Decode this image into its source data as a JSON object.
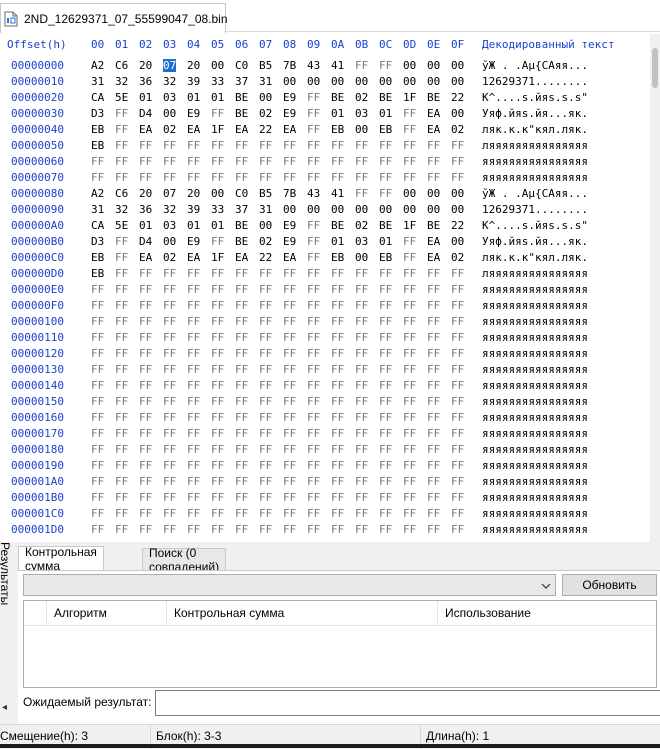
{
  "file_tab": {
    "name": "2ND_12629371_07_55599047_08.bin",
    "icon": "binary-file-icon"
  },
  "hex_header": {
    "offset": "Offset(h)",
    "columns": [
      "00",
      "01",
      "02",
      "03",
      "04",
      "05",
      "06",
      "07",
      "08",
      "09",
      "0A",
      "0B",
      "0C",
      "0D",
      "0E",
      "0F"
    ],
    "decoded": "Декодированный текст"
  },
  "hex_rows": [
    {
      "offset": "00000000",
      "bytes": [
        "A2",
        "C6",
        "20",
        "07",
        "20",
        "00",
        "C0",
        "B5",
        "7B",
        "43",
        "41",
        "FF",
        "FF",
        "00",
        "00",
        "00"
      ],
      "text": "ўЖ . .Аµ{CAяя...",
      "selected_index": 3
    },
    {
      "offset": "00000010",
      "bytes": [
        "31",
        "32",
        "36",
        "32",
        "39",
        "33",
        "37",
        "31",
        "00",
        "00",
        "00",
        "00",
        "00",
        "00",
        "00",
        "00"
      ],
      "text": "12629371........"
    },
    {
      "offset": "00000020",
      "bytes": [
        "CA",
        "5E",
        "01",
        "03",
        "01",
        "01",
        "BE",
        "00",
        "E9",
        "FF",
        "BE",
        "02",
        "BE",
        "1F",
        "BE",
        "22"
      ],
      "text": "К^....s.йяs.s.s\""
    },
    {
      "offset": "00000030",
      "bytes": [
        "D3",
        "FF",
        "D4",
        "00",
        "E9",
        "FF",
        "BE",
        "02",
        "E9",
        "FF",
        "01",
        "03",
        "01",
        "FF",
        "EA",
        "00"
      ],
      "text": "Уяф.йяs.йя...як."
    },
    {
      "offset": "00000040",
      "bytes": [
        "EB",
        "FF",
        "EA",
        "02",
        "EA",
        "1F",
        "EA",
        "22",
        "EA",
        "FF",
        "EB",
        "00",
        "EB",
        "FF",
        "EA",
        "02"
      ],
      "text": "ляк.к.к\"кял.ляк."
    },
    {
      "offset": "00000050",
      "bytes": [
        "EB",
        "FF",
        "FF",
        "FF",
        "FF",
        "FF",
        "FF",
        "FF",
        "FF",
        "FF",
        "FF",
        "FF",
        "FF",
        "FF",
        "FF",
        "FF"
      ],
      "text": "ляяяяяяяяяяяяяяя"
    },
    {
      "offset": "00000060",
      "bytes": [
        "FF",
        "FF",
        "FF",
        "FF",
        "FF",
        "FF",
        "FF",
        "FF",
        "FF",
        "FF",
        "FF",
        "FF",
        "FF",
        "FF",
        "FF",
        "FF"
      ],
      "text": "яяяяяяяяяяяяяяяя"
    },
    {
      "offset": "00000070",
      "bytes": [
        "FF",
        "FF",
        "FF",
        "FF",
        "FF",
        "FF",
        "FF",
        "FF",
        "FF",
        "FF",
        "FF",
        "FF",
        "FF",
        "FF",
        "FF",
        "FF"
      ],
      "text": "яяяяяяяяяяяяяяяя"
    },
    {
      "offset": "00000080",
      "bytes": [
        "A2",
        "C6",
        "20",
        "07",
        "20",
        "00",
        "C0",
        "B5",
        "7B",
        "43",
        "41",
        "FF",
        "FF",
        "00",
        "00",
        "00"
      ],
      "text": "ўЖ . .Аµ{CAяя..."
    },
    {
      "offset": "00000090",
      "bytes": [
        "31",
        "32",
        "36",
        "32",
        "39",
        "33",
        "37",
        "31",
        "00",
        "00",
        "00",
        "00",
        "00",
        "00",
        "00",
        "00"
      ],
      "text": "12629371........"
    },
    {
      "offset": "000000A0",
      "bytes": [
        "CA",
        "5E",
        "01",
        "03",
        "01",
        "01",
        "BE",
        "00",
        "E9",
        "FF",
        "BE",
        "02",
        "BE",
        "1F",
        "BE",
        "22"
      ],
      "text": "К^....s.йяs.s.s\""
    },
    {
      "offset": "000000B0",
      "bytes": [
        "D3",
        "FF",
        "D4",
        "00",
        "E9",
        "FF",
        "BE",
        "02",
        "E9",
        "FF",
        "01",
        "03",
        "01",
        "FF",
        "EA",
        "00"
      ],
      "text": "Уяф.йяs.йя...як."
    },
    {
      "offset": "000000C0",
      "bytes": [
        "EB",
        "FF",
        "EA",
        "02",
        "EA",
        "1F",
        "EA",
        "22",
        "EA",
        "FF",
        "EB",
        "00",
        "EB",
        "FF",
        "EA",
        "02"
      ],
      "text": "ляк.к.к\"кял.ляк."
    },
    {
      "offset": "000000D0",
      "bytes": [
        "EB",
        "FF",
        "FF",
        "FF",
        "FF",
        "FF",
        "FF",
        "FF",
        "FF",
        "FF",
        "FF",
        "FF",
        "FF",
        "FF",
        "FF",
        "FF"
      ],
      "text": "ляяяяяяяяяяяяяяя"
    },
    {
      "offset": "000000E0",
      "bytes": [
        "FF",
        "FF",
        "FF",
        "FF",
        "FF",
        "FF",
        "FF",
        "FF",
        "FF",
        "FF",
        "FF",
        "FF",
        "FF",
        "FF",
        "FF",
        "FF"
      ],
      "text": "яяяяяяяяяяяяяяяя"
    },
    {
      "offset": "000000F0",
      "bytes": [
        "FF",
        "FF",
        "FF",
        "FF",
        "FF",
        "FF",
        "FF",
        "FF",
        "FF",
        "FF",
        "FF",
        "FF",
        "FF",
        "FF",
        "FF",
        "FF"
      ],
      "text": "яяяяяяяяяяяяяяяя"
    },
    {
      "offset": "00000100",
      "bytes": [
        "FF",
        "FF",
        "FF",
        "FF",
        "FF",
        "FF",
        "FF",
        "FF",
        "FF",
        "FF",
        "FF",
        "FF",
        "FF",
        "FF",
        "FF",
        "FF"
      ],
      "text": "яяяяяяяяяяяяяяяя"
    },
    {
      "offset": "00000110",
      "bytes": [
        "FF",
        "FF",
        "FF",
        "FF",
        "FF",
        "FF",
        "FF",
        "FF",
        "FF",
        "FF",
        "FF",
        "FF",
        "FF",
        "FF",
        "FF",
        "FF"
      ],
      "text": "яяяяяяяяяяяяяяяя"
    },
    {
      "offset": "00000120",
      "bytes": [
        "FF",
        "FF",
        "FF",
        "FF",
        "FF",
        "FF",
        "FF",
        "FF",
        "FF",
        "FF",
        "FF",
        "FF",
        "FF",
        "FF",
        "FF",
        "FF"
      ],
      "text": "яяяяяяяяяяяяяяяя"
    },
    {
      "offset": "00000130",
      "bytes": [
        "FF",
        "FF",
        "FF",
        "FF",
        "FF",
        "FF",
        "FF",
        "FF",
        "FF",
        "FF",
        "FF",
        "FF",
        "FF",
        "FF",
        "FF",
        "FF"
      ],
      "text": "яяяяяяяяяяяяяяяя"
    },
    {
      "offset": "00000140",
      "bytes": [
        "FF",
        "FF",
        "FF",
        "FF",
        "FF",
        "FF",
        "FF",
        "FF",
        "FF",
        "FF",
        "FF",
        "FF",
        "FF",
        "FF",
        "FF",
        "FF"
      ],
      "text": "яяяяяяяяяяяяяяяя"
    },
    {
      "offset": "00000150",
      "bytes": [
        "FF",
        "FF",
        "FF",
        "FF",
        "FF",
        "FF",
        "FF",
        "FF",
        "FF",
        "FF",
        "FF",
        "FF",
        "FF",
        "FF",
        "FF",
        "FF"
      ],
      "text": "яяяяяяяяяяяяяяяя"
    },
    {
      "offset": "00000160",
      "bytes": [
        "FF",
        "FF",
        "FF",
        "FF",
        "FF",
        "FF",
        "FF",
        "FF",
        "FF",
        "FF",
        "FF",
        "FF",
        "FF",
        "FF",
        "FF",
        "FF"
      ],
      "text": "яяяяяяяяяяяяяяяя"
    },
    {
      "offset": "00000170",
      "bytes": [
        "FF",
        "FF",
        "FF",
        "FF",
        "FF",
        "FF",
        "FF",
        "FF",
        "FF",
        "FF",
        "FF",
        "FF",
        "FF",
        "FF",
        "FF",
        "FF"
      ],
      "text": "яяяяяяяяяяяяяяяя"
    },
    {
      "offset": "00000180",
      "bytes": [
        "FF",
        "FF",
        "FF",
        "FF",
        "FF",
        "FF",
        "FF",
        "FF",
        "FF",
        "FF",
        "FF",
        "FF",
        "FF",
        "FF",
        "FF",
        "FF"
      ],
      "text": "яяяяяяяяяяяяяяяя"
    },
    {
      "offset": "00000190",
      "bytes": [
        "FF",
        "FF",
        "FF",
        "FF",
        "FF",
        "FF",
        "FF",
        "FF",
        "FF",
        "FF",
        "FF",
        "FF",
        "FF",
        "FF",
        "FF",
        "FF"
      ],
      "text": "яяяяяяяяяяяяяяяя"
    },
    {
      "offset": "000001A0",
      "bytes": [
        "FF",
        "FF",
        "FF",
        "FF",
        "FF",
        "FF",
        "FF",
        "FF",
        "FF",
        "FF",
        "FF",
        "FF",
        "FF",
        "FF",
        "FF",
        "FF"
      ],
      "text": "яяяяяяяяяяяяяяяя"
    },
    {
      "offset": "000001B0",
      "bytes": [
        "FF",
        "FF",
        "FF",
        "FF",
        "FF",
        "FF",
        "FF",
        "FF",
        "FF",
        "FF",
        "FF",
        "FF",
        "FF",
        "FF",
        "FF",
        "FF"
      ],
      "text": "яяяяяяяяяяяяяяяя"
    },
    {
      "offset": "000001C0",
      "bytes": [
        "FF",
        "FF",
        "FF",
        "FF",
        "FF",
        "FF",
        "FF",
        "FF",
        "FF",
        "FF",
        "FF",
        "FF",
        "FF",
        "FF",
        "FF",
        "FF"
      ],
      "text": "яяяяяяяяяяяяяяяя"
    },
    {
      "offset": "000001D0",
      "bytes": [
        "FF",
        "FF",
        "FF",
        "FF",
        "FF",
        "FF",
        "FF",
        "FF",
        "FF",
        "FF",
        "FF",
        "FF",
        "FF",
        "FF",
        "FF",
        "FF"
      ],
      "text": "яяяяяяяяяяяяяяяя"
    }
  ],
  "side_panel": {
    "label": "Результаты",
    "pin_icon": "pin-icon"
  },
  "results_panel": {
    "tabs": [
      {
        "label": "Контрольная сумма",
        "active": true
      },
      {
        "label": "Поиск (0 совпадений)",
        "active": false
      }
    ],
    "algorithm_select": {
      "value": ""
    },
    "refresh_button": "Обновить",
    "columns": [
      "Алгоритм",
      "Контрольная сумма",
      "Использование"
    ],
    "expected_label": "Ожидаемый результат:",
    "expected_value": ""
  },
  "status_bar": {
    "offset": "Смещение(h): 3",
    "block": "Блок(h): 3-3",
    "length": "Длина(h): 1"
  },
  "colors": {
    "offset_blue": "#1a3fd0",
    "selection": "#1f6fd1",
    "ff_grey": "#7a7a7a"
  }
}
